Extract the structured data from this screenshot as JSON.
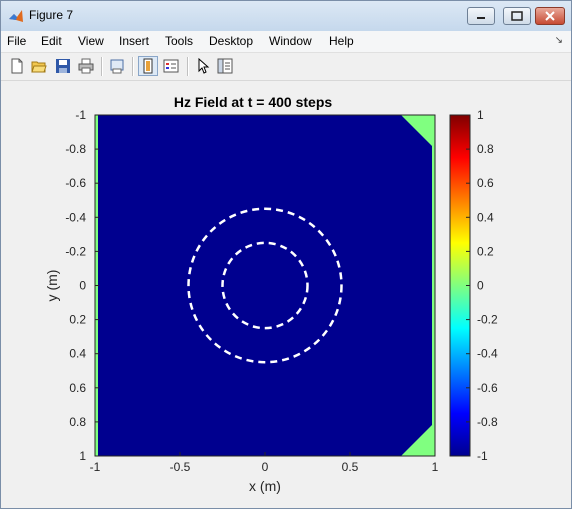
{
  "window": {
    "title": "Figure 7",
    "menu": [
      "File",
      "Edit",
      "View",
      "Insert",
      "Tools",
      "Desktop",
      "Window",
      "Help"
    ],
    "toolbar_icons": [
      "new-figure-icon",
      "open-file-icon",
      "save-icon",
      "print-icon",
      "print-preview-icon",
      "colorbar-toggle-icon",
      "legend-toggle-icon",
      "pointer-icon",
      "property-editor-icon"
    ]
  },
  "chart_data": {
    "type": "heatmap",
    "title": "Hz Field at t = 400 steps",
    "xlabel": "x (m)",
    "ylabel": "y (m)",
    "xlim": [
      -1,
      1
    ],
    "ylim": [
      -1,
      1
    ],
    "y_direction": "reversed",
    "xticks": [
      "-1",
      "-0.5",
      "0",
      "0.5",
      "1"
    ],
    "yticks": [
      "-1",
      "-0.8",
      "-0.6",
      "-0.4",
      "-0.2",
      "0",
      "0.2",
      "0.4",
      "0.6",
      "0.8",
      "1"
    ],
    "field_background_value": -1,
    "corner_value_approx": 0.1,
    "corner_regions": [
      "top-right",
      "bottom-right"
    ],
    "dashed_circles": [
      {
        "center": [
          0,
          0
        ],
        "radius": 0.45,
        "color": "#ffffff"
      },
      {
        "center": [
          0,
          0
        ],
        "radius": 0.25,
        "color": "#ffffff"
      }
    ],
    "colorbar": {
      "min": -1,
      "max": 1,
      "ticks": [
        "1",
        "0.8",
        "0.6",
        "0.4",
        "0.2",
        "0",
        "-0.2",
        "-0.4",
        "-0.6",
        "-0.8",
        "-1"
      ],
      "colormap": "jet"
    },
    "colors": {
      "field": "#00008f",
      "corner": "#80ff80",
      "edge": "#80ff80"
    }
  }
}
